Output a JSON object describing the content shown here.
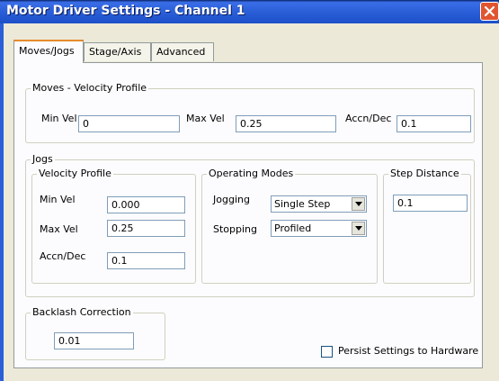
{
  "window": {
    "title": "Motor Driver Settings - Channel 1"
  },
  "tabs": [
    {
      "label": "Moves/Jogs",
      "active": true
    },
    {
      "label": "Stage/Axis",
      "active": false
    },
    {
      "label": "Advanced",
      "active": false
    }
  ],
  "moves": {
    "legend": "Moves - Velocity Profile",
    "min_vel_label": "Min Vel",
    "min_vel": "0",
    "max_vel_label": "Max Vel",
    "max_vel": "0.25",
    "accn_label": "Accn/Dec",
    "accn": "0.1"
  },
  "jogs": {
    "legend": "Jogs",
    "velocity_profile": {
      "legend": "Velocity Profile",
      "min_vel_label": "Min Vel",
      "min_vel": "0.000",
      "max_vel_label": "Max Vel",
      "max_vel": "0.25",
      "accn_label": "Accn/Dec",
      "accn": "0.1"
    },
    "operating_modes": {
      "legend": "Operating Modes",
      "jogging_label": "Jogging",
      "jogging_value": "Single Step",
      "stopping_label": "Stopping",
      "stopping_value": "Profiled"
    },
    "step_distance": {
      "legend": "Step Distance",
      "value": "0.1"
    }
  },
  "backlash": {
    "legend": "Backlash Correction",
    "value": "0.01"
  },
  "persist": {
    "label": "Persist Settings to Hardware",
    "checked": false
  },
  "colors": {
    "titlebar": "#2a5fd8",
    "dialog": "#ece9d8",
    "panel": "#fcfcfe",
    "tab_highlight": "#e68b2c",
    "close": "#e0552f"
  }
}
